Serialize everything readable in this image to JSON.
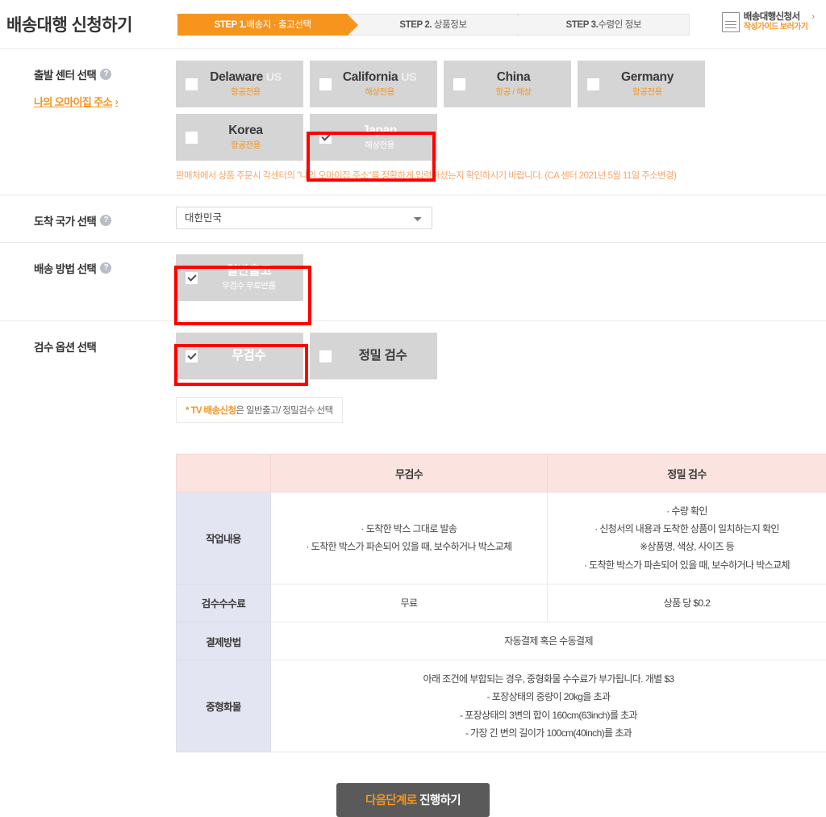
{
  "header": {
    "title": "배송대행 신청하기",
    "steps": [
      {
        "num": "STEP 1.",
        "label": "배송지 · 출고선택",
        "active": true
      },
      {
        "num": "STEP 2.",
        "label": " 상품정보",
        "active": false
      },
      {
        "num": "STEP 3.",
        "label": "수령인 정보",
        "active": false
      }
    ],
    "guide": {
      "icon": "document-icon",
      "line1": "배송대행신청서",
      "line2": "작성가이드 보러가기",
      "chevron": "›"
    }
  },
  "sections": {
    "center": {
      "label": "출발 센터 선택",
      "help_icon": "?",
      "my_address_link": "나의 오마이집 주소",
      "my_address_chevron": "›",
      "centers_row1": [
        {
          "name": "Delaware",
          "country": "US",
          "sub": "항공전용",
          "checked": false,
          "selected": false
        },
        {
          "name": "California",
          "country": "US",
          "sub": "해상전용",
          "checked": false,
          "selected": false
        },
        {
          "name": "China",
          "country": "",
          "sub": "항공 / 해상",
          "checked": false,
          "selected": false
        },
        {
          "name": "Germany",
          "country": "",
          "sub": "항공전용",
          "checked": false,
          "selected": false
        }
      ],
      "centers_row2": [
        {
          "name": "Korea",
          "country": "",
          "sub": "항공전용",
          "checked": false,
          "selected": false
        },
        {
          "name": "Japan",
          "country": "",
          "sub": "해상전용",
          "checked": true,
          "selected": true
        }
      ],
      "notice": "판매처에서 상품 주문시 각센터의 \"나의 오마이집 주소\"를 정확하게 입력하셨는지 확인하시기 바랍니다. (CA 센터 2021년 5월 11일 주소변경)"
    },
    "country": {
      "label": "도착 국가 선택",
      "help_icon": "?",
      "selected": "대한민국",
      "options": [
        "대한민국"
      ]
    },
    "shipping": {
      "label": "배송 방법 선택",
      "help_icon": "?",
      "options": [
        {
          "name": "일반출고",
          "sub": "무검수 무료반품",
          "checked": true,
          "selected": true
        }
      ]
    },
    "inspection": {
      "label": "검수 옵션 선택",
      "options": [
        {
          "name": "무검수",
          "sub": "",
          "checked": true,
          "selected": true
        },
        {
          "name": "정밀 검수",
          "sub": "",
          "checked": false,
          "selected": false
        }
      ],
      "tv_note_em": "* TV 배송신청",
      "tv_note_rest": "은 일반출고/ 정밀검수 선택"
    }
  },
  "comparison_table": {
    "headers": [
      "",
      "무검수",
      "정밀 검수"
    ],
    "rows": [
      {
        "label": "작업내용",
        "merged": false,
        "cells": [
          [
            "· 도착한 박스 그대로 발송",
            "· 도착한 박스가 파손되어 있을 때, 보수하거나 박스교체"
          ],
          [
            "· 수량 확인",
            "· 신청서의 내용과 도착한 상품이 일치하는지 확인",
            "※상품명, 색상, 사이즈 등",
            "· 도착한 박스가 파손되어 있을 때, 보수하거나 박스교체"
          ]
        ]
      },
      {
        "label": "검수수수료",
        "merged": false,
        "cells": [
          [
            "무료"
          ],
          [
            "상품 당 $0.2"
          ]
        ]
      },
      {
        "label": "결제방법",
        "merged": true,
        "cells": [
          [
            "자동결제 혹은 수동결제"
          ]
        ]
      },
      {
        "label": "중형화물",
        "merged": true,
        "cells": [
          [
            "아래 조건에 부합되는 경우, 중형화물 수수료가 부가됩니다. 개별 $3",
            "- 포장상태의 중량이 20kg을 초과",
            "- 포장상태의 3변의 합이 160cm(63inch)를 초과",
            "- 가장 긴 변의 길이가 100cm(40inch)를 초과"
          ]
        ]
      }
    ]
  },
  "footer": {
    "submit_accent": "다음단계로",
    "submit_rest": " 진행하기"
  },
  "colors": {
    "accent": "#f7941e",
    "highlight": "#ff0000",
    "card_bg": "#d5d5d5",
    "table_header_bg": "#fbe4df",
    "table_rowheader_bg": "#e4e5f2",
    "submit_bg": "#5a5a5a"
  }
}
